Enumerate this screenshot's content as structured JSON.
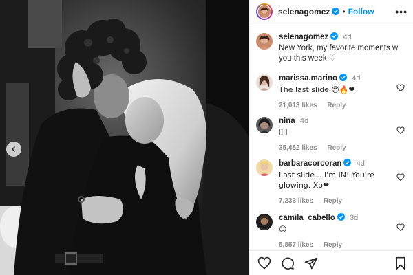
{
  "post": {
    "username": "selenagomez",
    "follow_label": "Follow",
    "separator": "•",
    "more_label": "•••",
    "caption": {
      "username": "selenagomez",
      "time": "4d",
      "text": "New York, my favorite moments w you this week ♡"
    }
  },
  "comments": [
    {
      "username": "marissa.marino",
      "verified": true,
      "time": "4d",
      "text": "The last slide 😍🔥❤",
      "likes": "21,013 likes",
      "reply": "Reply"
    },
    {
      "username": "nina",
      "verified": false,
      "time": "4d",
      "text": "▯▯",
      "likes": "35,482 likes",
      "reply": "Reply"
    },
    {
      "username": "barbaracorcoran",
      "verified": true,
      "time": "4d",
      "text": "Last slide... I'm IN! You're glowing. Xo❤",
      "likes": "7,233 likes",
      "reply": "Reply"
    },
    {
      "username": "camila_cabello",
      "verified": true,
      "time": "3d",
      "text": "😍",
      "likes": "5,857 likes",
      "reply": "Reply"
    }
  ],
  "icons": {
    "like": "heart-outline-icon",
    "comment": "speech-bubble-icon",
    "share": "paper-plane-icon",
    "save": "bookmark-icon",
    "carousel_prev": "chevron-left-icon"
  },
  "colors": {
    "accent": "#0095f6",
    "verified": "#0095f6",
    "muted": "#8e8e8e",
    "text": "#262626"
  }
}
